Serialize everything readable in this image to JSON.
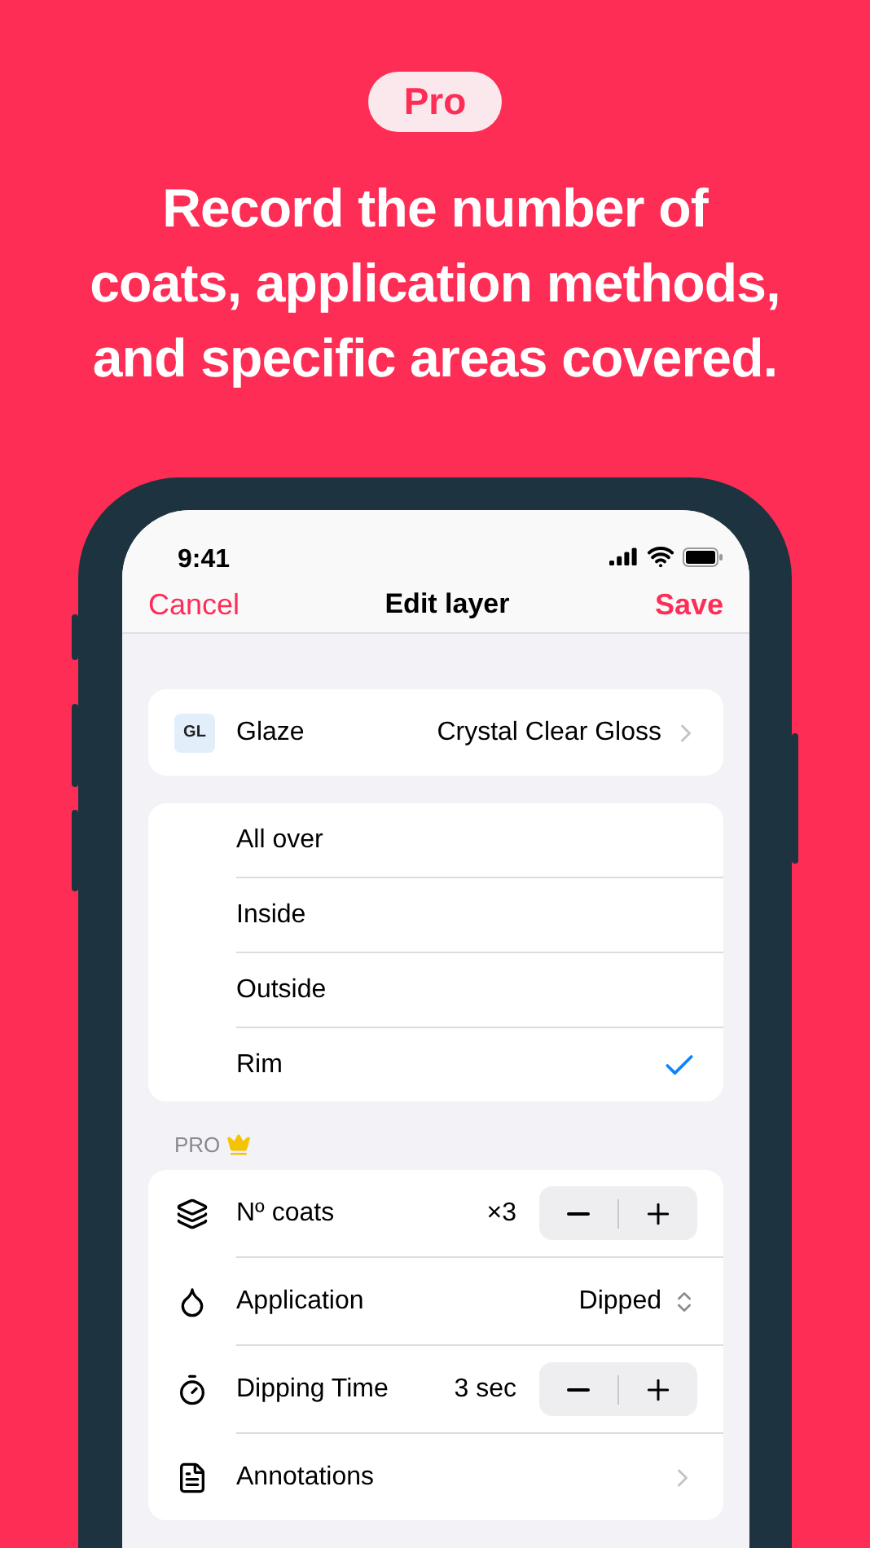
{
  "header": {
    "badge": "Pro",
    "headline": [
      "Record the number of",
      "coats, application methods,",
      "and specific areas covered."
    ]
  },
  "status_bar": {
    "time": "9:41"
  },
  "nav": {
    "cancel": "Cancel",
    "title": "Edit layer",
    "save": "Save"
  },
  "glaze": {
    "badge": "GL",
    "label": "Glaze",
    "value": "Crystal Clear Gloss"
  },
  "areas": [
    {
      "label": "All over",
      "selected": false
    },
    {
      "label": "Inside",
      "selected": false
    },
    {
      "label": "Outside",
      "selected": false
    },
    {
      "label": "Rim",
      "selected": true
    }
  ],
  "pro_section": {
    "title": "PRO",
    "rows": [
      {
        "kind": "stepper",
        "label": "Nº coats",
        "value": "×3"
      },
      {
        "kind": "select",
        "label": "Application",
        "value": "Dipped"
      },
      {
        "kind": "stepper",
        "label": "Dipping Time",
        "value": "3 sec"
      },
      {
        "kind": "link",
        "label": "Annotations"
      }
    ]
  }
}
